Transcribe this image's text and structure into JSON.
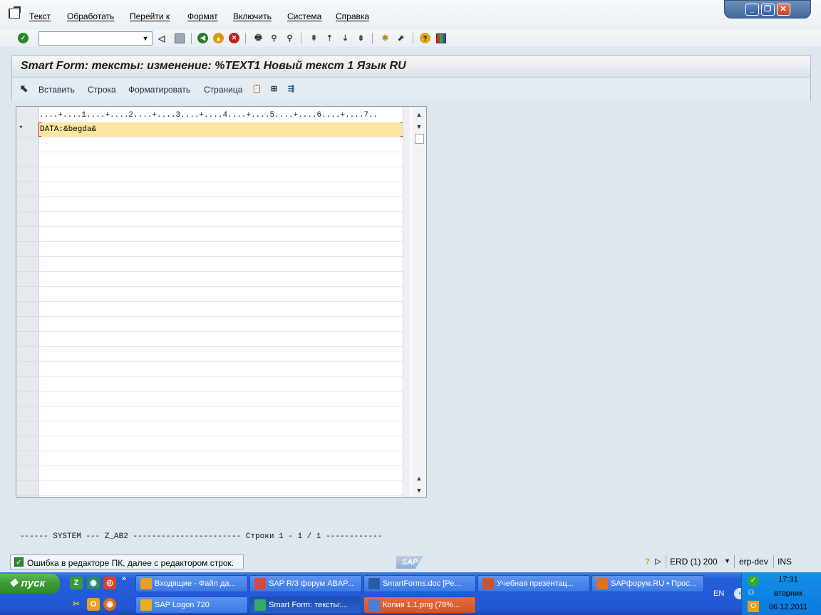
{
  "menu": {
    "items": [
      "Текст",
      "Обработать",
      "Перейти к",
      "Формат",
      "Включить",
      "Система",
      "Справка"
    ]
  },
  "window_controls": {
    "minimize": "_",
    "restore": "❐",
    "close": "✕"
  },
  "toolbar": {
    "command_field_value": "",
    "icons": [
      "enter-icon",
      "save-icon",
      "back-icon",
      "exit-icon",
      "cancel-icon",
      "print-icon",
      "find-icon",
      "find-next-icon",
      "first-page-icon",
      "previous-page-icon",
      "next-page-icon",
      "last-page-icon",
      "new-session-icon",
      "shortcut-icon",
      "help-icon",
      "customize-layout-icon"
    ]
  },
  "title": "Smart Form: тексты: изменение: %TEXT1 Новый текст 1 Язык RU",
  "app_toolbar": {
    "insert": "Вставить",
    "line": "Строка",
    "format": "Форматировать",
    "page": "Страница"
  },
  "editor": {
    "ruler": "....+....1....+....2....+....3....+....4....+....5....+....6....+....7..",
    "lines": [
      {
        "marker": "*",
        "text": "DATA:&begda&"
      }
    ],
    "empty_rows": 24
  },
  "editor_status": "------ SYSTEM --- Z_AB2 ----------------------- Строки 1 - 1 / 1 ------------",
  "status": {
    "message": "Ошибка в редакторе ПК, далее с редактором строк.",
    "sap_logo": "SAP",
    "system": "ERD (1) 200",
    "server": "erp-dev",
    "mode": "INS"
  },
  "taskbar": {
    "start": "пуск",
    "tasks_row1": [
      {
        "label": "Входящие - Файл да...",
        "icon": "outlook-icon",
        "color": "#e8a020"
      },
      {
        "label": "SAP R/3 форум ABAP...",
        "icon": "chrome-icon",
        "color": "#d44"
      },
      {
        "label": "SmartForms.doc [Ре...",
        "icon": "word-icon",
        "color": "#2b5ca8"
      },
      {
        "label": "Учебная презентац...",
        "icon": "powerpoint-icon",
        "color": "#d2502a"
      },
      {
        "label": "SAPфорум.RU • Прос...",
        "icon": "firefox-icon",
        "color": "#e07020"
      }
    ],
    "tasks_row2": [
      {
        "label": "SAP Logon 720",
        "icon": "sap-logon-icon",
        "color": "#e8b020"
      },
      {
        "label": "Smart Form: тексты:...",
        "icon": "sap-gui-icon",
        "color": "#3a6"
      },
      {
        "label": "Копия 1.1.png (78%...",
        "icon": "image-viewer-icon",
        "color": "#4a7fd8"
      }
    ],
    "language": "EN",
    "time": "17:31",
    "day": "вторник",
    "date": "06.12.2011"
  }
}
